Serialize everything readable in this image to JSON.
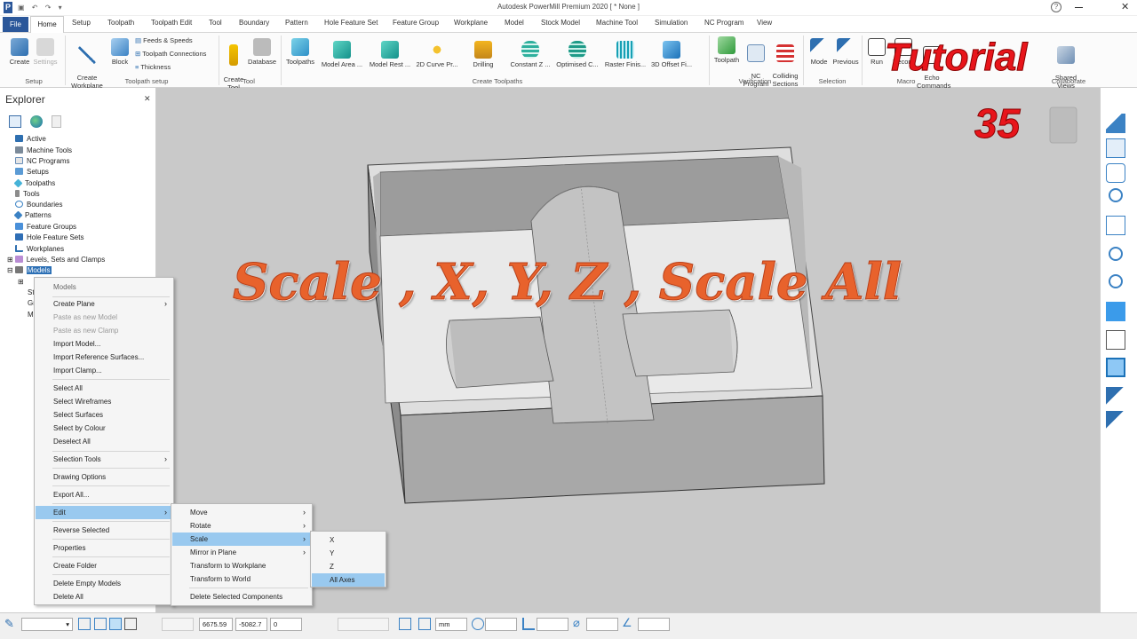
{
  "app": {
    "title": "Autodesk PowerMill Premium 2020   [ * None ]"
  },
  "tabs": [
    "File",
    "Home",
    "Setup",
    "Toolpath",
    "Toolpath Edit",
    "Tool",
    "Boundary",
    "Pattern",
    "Hole Feature Set",
    "Feature Group",
    "Workplane",
    "Model",
    "Stock Model",
    "Machine Tool",
    "Simulation",
    "NC Program",
    "View"
  ],
  "ribbon": {
    "setup_group": "Setup",
    "toolpath_setup_group": "Toolpath setup",
    "tool_group": "Tool",
    "create_toolpaths_group": "Create Toolpaths",
    "verification_group": "Verification",
    "selection_group": "Selection",
    "macro_group": "Macro",
    "collaborate_group": "Collaborate",
    "create": "Create",
    "settings": "Settings",
    "create_workplane": "Create\nWorkplane",
    "block": "Block",
    "feeds_speeds": "Feeds & Speeds",
    "toolpath_connections": "Toolpath Connections",
    "thickness": "Thickness",
    "create_tool": "Create\nTool",
    "database": "Database",
    "toolpaths": "Toolpaths",
    "model_area": "Model Area ...",
    "model_rest": "Model Rest ...",
    "curve_2d": "2D Curve Pr...",
    "drilling": "Drilling",
    "constant_z": "Constant Z ...",
    "optimised": "Optimised C...",
    "raster": "Raster Finis...",
    "offset_3d": "3D Offset Fi...",
    "toolpath_verif": "Toolpath",
    "nc_program": "NC\nProgram",
    "colliding_sections": "Colliding\nSections",
    "mode": "Mode",
    "previous": "Previous",
    "run": "Run",
    "record": "Record",
    "echo_commands": "Echo\nCommands",
    "shared_views": "Shared\nViews"
  },
  "explorer": {
    "title": "Explorer",
    "items": [
      "Active",
      "Machine Tools",
      "NC Programs",
      "Setups",
      "Toolpaths",
      "Tools",
      "Boundaries",
      "Patterns",
      "Feature Groups",
      "Hole Feature Sets",
      "Workplanes",
      "Levels, Sets and Clamps",
      "Models"
    ],
    "partial_items": [
      "St",
      "Gr",
      "M"
    ]
  },
  "context_menu": {
    "header": "Models",
    "items": [
      "Create Plane",
      "Paste as new Model",
      "Paste as new Clamp",
      "Import Model...",
      "Import Reference Surfaces...",
      "Import Clamp...",
      "Select All",
      "Select Wireframes",
      "Select Surfaces",
      "Select by Colour",
      "Deselect All",
      "Selection Tools",
      "Drawing Options",
      "Export All...",
      "Edit",
      "Reverse Selected",
      "Properties",
      "Create Folder",
      "Delete Empty Models",
      "Delete All"
    ]
  },
  "edit_submenu": {
    "items": [
      "Move",
      "Rotate",
      "Scale",
      "Mirror in Plane",
      "Transform to Workplane",
      "Transform to World",
      "Delete Selected Components"
    ]
  },
  "scale_submenu": {
    "items": [
      "X",
      "Y",
      "Z",
      "All Axes"
    ]
  },
  "overlay": {
    "headline": "Scale , X, Y, Z , Scale All",
    "tutorial": "Tutorial",
    "number": "35"
  },
  "status": {
    "x": "6675.59",
    "y": "-5082.7",
    "z": "0",
    "units": "mm"
  },
  "colors": {
    "accent": "#2b579a",
    "highlight": "#99c9ef",
    "overlay_text": "#e8622c",
    "tutorial_red": "#e8151b"
  }
}
